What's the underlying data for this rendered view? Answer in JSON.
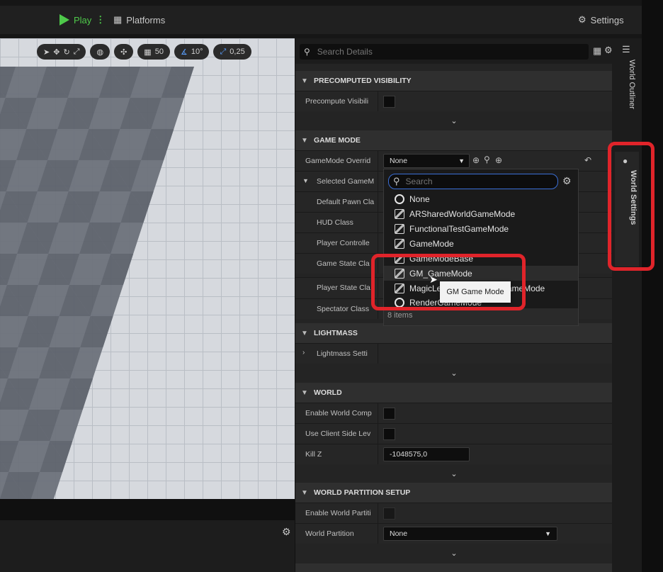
{
  "toolbar": {
    "play_label": "Play",
    "platforms_label": "Platforms",
    "settings_label": "Settings"
  },
  "viewport": {
    "grid_size": "50",
    "rotation_snap": "10°",
    "scale_snap": "0,25"
  },
  "details": {
    "search_placeholder": "Search Details",
    "sections": {
      "precomputed_visibility": "PRECOMPUTED VISIBILITY",
      "game_mode": "GAME MODE",
      "lightmass": "LIGHTMASS",
      "world": "WORLD",
      "world_partition_setup": "WORLD PARTITION SETUP"
    },
    "rows": {
      "precompute_visibility": "Precompute Visibili",
      "gamemode_override": "GameMode Overrid",
      "gamemode_override_value": "None",
      "selected_gamemode": "Selected GameM",
      "default_pawn": "Default Pawn Cla",
      "hud_class": "HUD Class",
      "player_controller": "Player Controlle",
      "game_state": "Game State Cla",
      "player_state": "Player State Cla",
      "spectator_class": "Spectator Class",
      "lightmass_settings": "Lightmass Setti",
      "enable_world_comp": "Enable World Comp",
      "use_client_side": "Use Client Side Lev",
      "kill_z": "Kill Z",
      "kill_z_value": "-1048575,0",
      "enable_world_partition": "Enable World Partiti",
      "world_partition": "World Partition",
      "world_partition_value": "None"
    }
  },
  "side_tabs": {
    "world_outliner": "World Outliner",
    "world_settings": "World Settings"
  },
  "dropdown": {
    "search_placeholder": "Search",
    "items": [
      {
        "label": "None",
        "icon": "circle-icon"
      },
      {
        "label": "ARSharedWorldGameMode",
        "icon": "blueprint-icon"
      },
      {
        "label": "FunctionalTestGameMode",
        "icon": "blueprint-icon"
      },
      {
        "label": "GameMode",
        "icon": "blueprint-icon"
      },
      {
        "label": "GameModeBase",
        "icon": "blueprint-icon"
      },
      {
        "label": "GM_GameMode",
        "icon": "blueprint-icon"
      },
      {
        "label": "MagicLeapSharedWorldGameMode",
        "icon": "blueprint-icon"
      },
      {
        "label": "RenderGameMode",
        "icon": "circle-icon"
      }
    ],
    "footer": "8 items"
  },
  "tooltip": "GM Game Mode",
  "colors": {
    "highlight_red": "#e0242a",
    "play_green": "#4ec94a",
    "focus_blue": "#3b6fd6"
  }
}
